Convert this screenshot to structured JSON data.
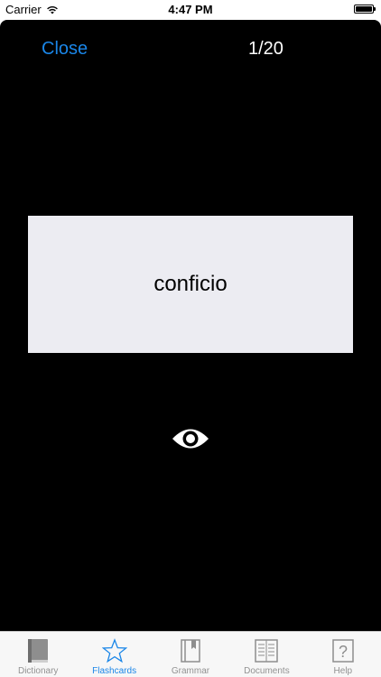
{
  "status_bar": {
    "carrier": "Carrier",
    "time": "4:47 PM"
  },
  "header": {
    "close_label": "Close",
    "counter": "1/20"
  },
  "card": {
    "word": "conficio"
  },
  "tabs": [
    {
      "label": "Dictionary",
      "icon": "book-icon",
      "active": false
    },
    {
      "label": "Flashcards",
      "icon": "star-icon",
      "active": true
    },
    {
      "label": "Grammar",
      "icon": "bookmark-book-icon",
      "active": false
    },
    {
      "label": "Documents",
      "icon": "documents-icon",
      "active": false
    },
    {
      "label": "Help",
      "icon": "help-icon",
      "active": false
    }
  ],
  "colors": {
    "accent": "#1a86e8",
    "card_background": "#ececf2",
    "screen_background": "#000000"
  }
}
